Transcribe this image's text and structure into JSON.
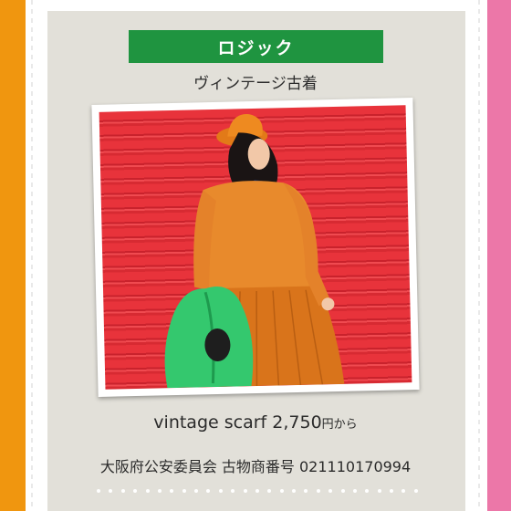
{
  "shop": {
    "name": "ロジック",
    "subtitle": "ヴィンテージ古着"
  },
  "photo": {
    "icon": "vintage-orange-dress-photo"
  },
  "price": {
    "item": "vintage scarf 2,750",
    "suffix": "円から"
  },
  "license": {
    "text": "大阪府公安委員会 古物商番号 021110170994"
  },
  "colors": {
    "left_stripe": "#F0960F",
    "right_stripe": "#EC77A8",
    "banner": "#1F9440",
    "panel": "#E2E0D9",
    "photo_background": "#E8333B"
  }
}
